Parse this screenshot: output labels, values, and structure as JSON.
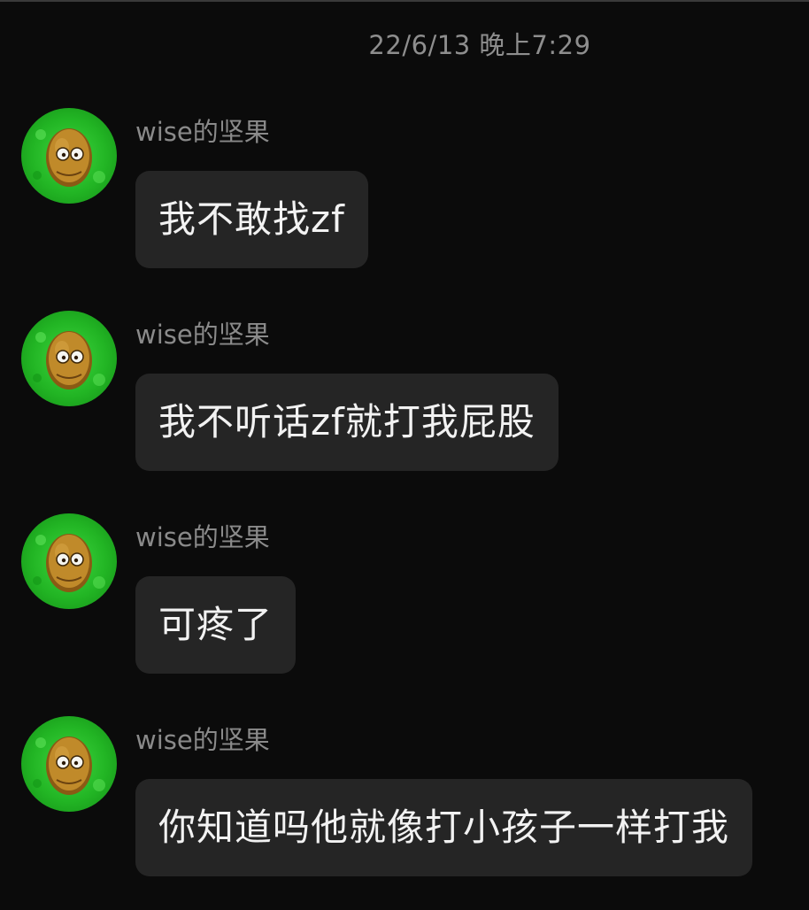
{
  "chat": {
    "timestamp": "22/6/13 晚上7:29",
    "messages": [
      {
        "sender": "wise的坚果",
        "text": "我不敢找zf"
      },
      {
        "sender": "wise的坚果",
        "text": "我不听话zf就打我屁股"
      },
      {
        "sender": "wise的坚果",
        "text": "可疼了"
      },
      {
        "sender": "wise的坚果",
        "text": "你知道吗他就像打小孩子一样打我"
      }
    ],
    "avatar_icon": "wall-nut-icon"
  },
  "colors": {
    "background": "#0b0b0b",
    "bubble": "#252525",
    "sender_text": "#8a8a8a",
    "message_text": "#f2f2f2",
    "avatar_green": "#22b524"
  }
}
